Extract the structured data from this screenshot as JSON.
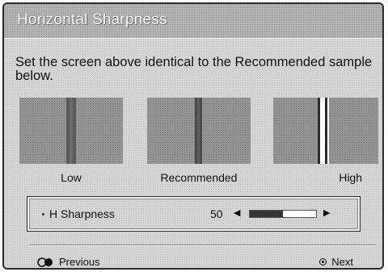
{
  "dialog": {
    "title": "Horizontal Sharpness",
    "instruction": "Set the screen above identical to the Recommended sample below."
  },
  "samples": [
    {
      "label": "Low"
    },
    {
      "label": "Recommended"
    },
    {
      "label": "High"
    }
  ],
  "control": {
    "label": "H Sharpness",
    "value": "50",
    "level_fraction": 0.5
  },
  "nav": {
    "previous_label": "Previous",
    "next_label": "Next"
  }
}
